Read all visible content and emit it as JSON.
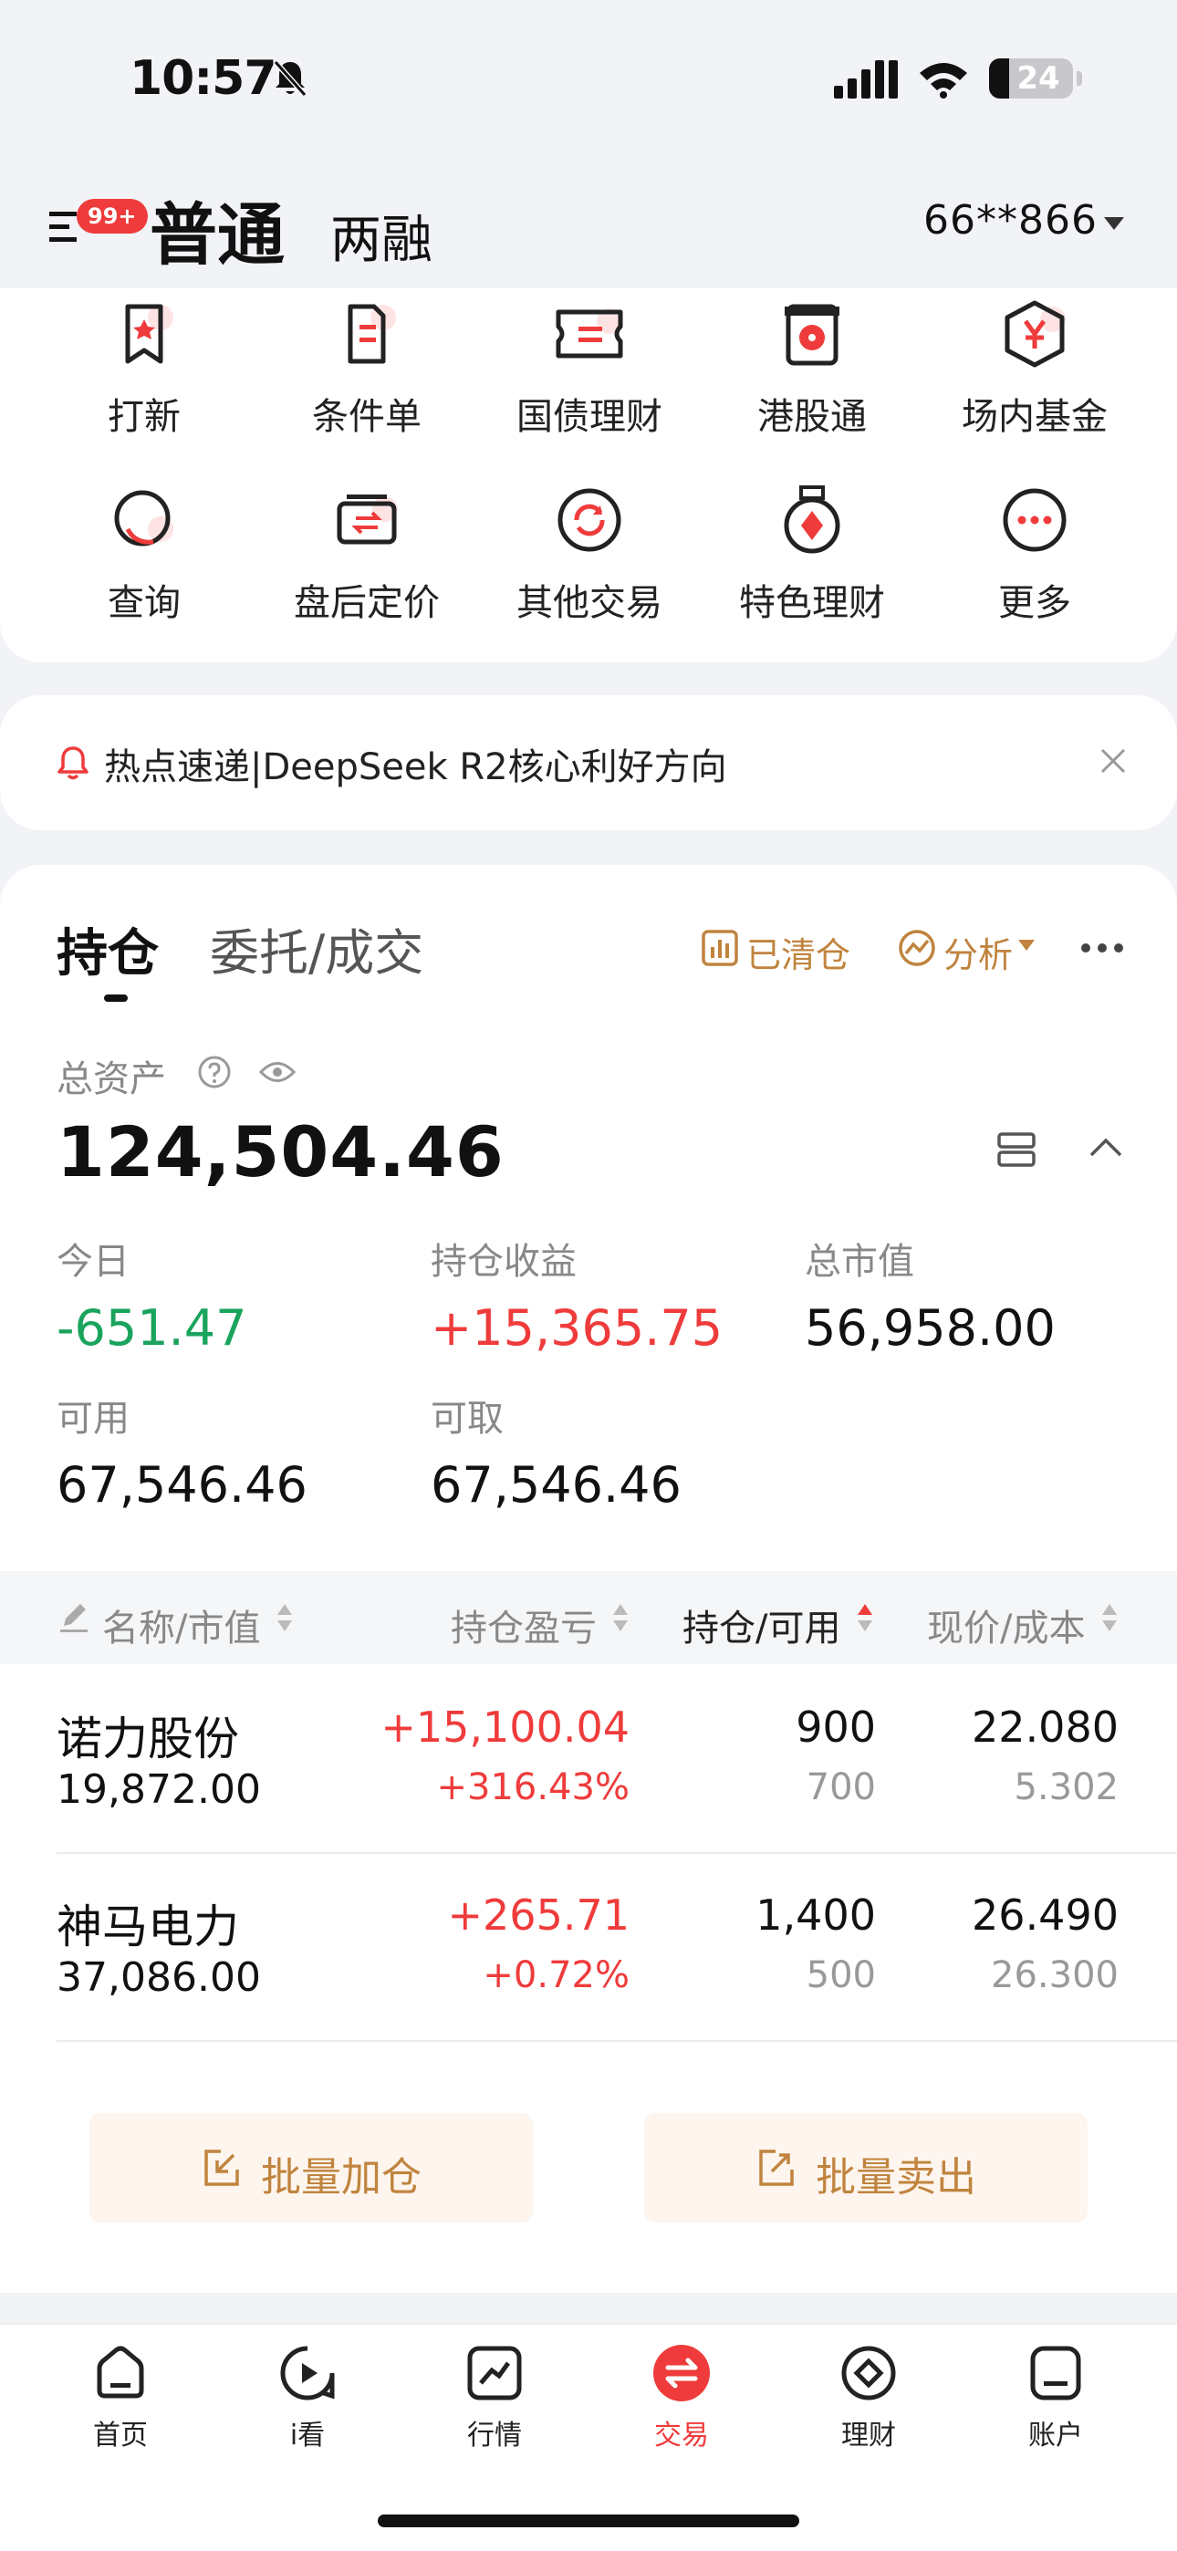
{
  "status_bar": {
    "time": "10:57",
    "battery": "24"
  },
  "header": {
    "badge": "99+",
    "title": "普通",
    "subtitle": "两融",
    "account": "66**866"
  },
  "quick_menu": [
    {
      "label": "打新",
      "icon": "ipo-bookmark-icon"
    },
    {
      "label": "条件单",
      "icon": "condition-order-icon"
    },
    {
      "label": "国债理财",
      "icon": "bond-ticket-icon"
    },
    {
      "label": "港股通",
      "icon": "hk-connect-icon"
    },
    {
      "label": "场内基金",
      "icon": "yen-fund-icon"
    },
    {
      "label": "查询",
      "icon": "query-icon"
    },
    {
      "label": "盘后定价",
      "icon": "after-hours-icon"
    },
    {
      "label": "其他交易",
      "icon": "refresh-icon"
    },
    {
      "label": "特色理财",
      "icon": "medal-icon"
    },
    {
      "label": "更多",
      "icon": "more-icon"
    }
  ],
  "news": {
    "text": "热点速递|DeepSeek R2核心利好方向"
  },
  "holdings": {
    "tab_active": "持仓",
    "tab_other": "委托/成交",
    "action_cleared": "已清仓",
    "action_analysis": "分析",
    "total_assets_label": "总资产",
    "total_assets": "124,504.46",
    "today_label": "今日",
    "today_value": "-651.47",
    "position_profit_label": "持仓收益",
    "position_profit_value": "+15,365.75",
    "market_value_label": "总市值",
    "market_value": "56,958.00",
    "available_label": "可用",
    "available_value": "67,546.46",
    "withdrawable_label": "可取",
    "withdrawable_value": "67,546.46"
  },
  "table": {
    "headers": [
      "名称/市值",
      "持仓盈亏",
      "持仓/可用",
      "现价/成本"
    ],
    "rows": [
      {
        "name": "诺力股份",
        "market_value": "19,872.00",
        "pl": "+15,100.04",
        "pl_pct": "+316.43%",
        "position": "900",
        "available": "700",
        "price": "22.080",
        "cost": "5.302"
      },
      {
        "name": "神马电力",
        "market_value": "37,086.00",
        "pl": "+265.71",
        "pl_pct": "+0.72%",
        "position": "1,400",
        "available": "500",
        "price": "26.490",
        "cost": "26.300"
      }
    ]
  },
  "batch": {
    "add": "批量加仓",
    "sell": "批量卖出"
  },
  "tabbar": [
    {
      "label": "首页",
      "icon": "home-icon"
    },
    {
      "label": "i看",
      "icon": "play-icon"
    },
    {
      "label": "行情",
      "icon": "chart-icon"
    },
    {
      "label": "交易",
      "icon": "trade-icon"
    },
    {
      "label": "理财",
      "icon": "wealth-icon"
    },
    {
      "label": "账户",
      "icon": "account-icon"
    }
  ],
  "colors": {
    "accent_red": "#ef3b3b",
    "profit_green": "#1aa35c",
    "gold": "#c0843e"
  }
}
